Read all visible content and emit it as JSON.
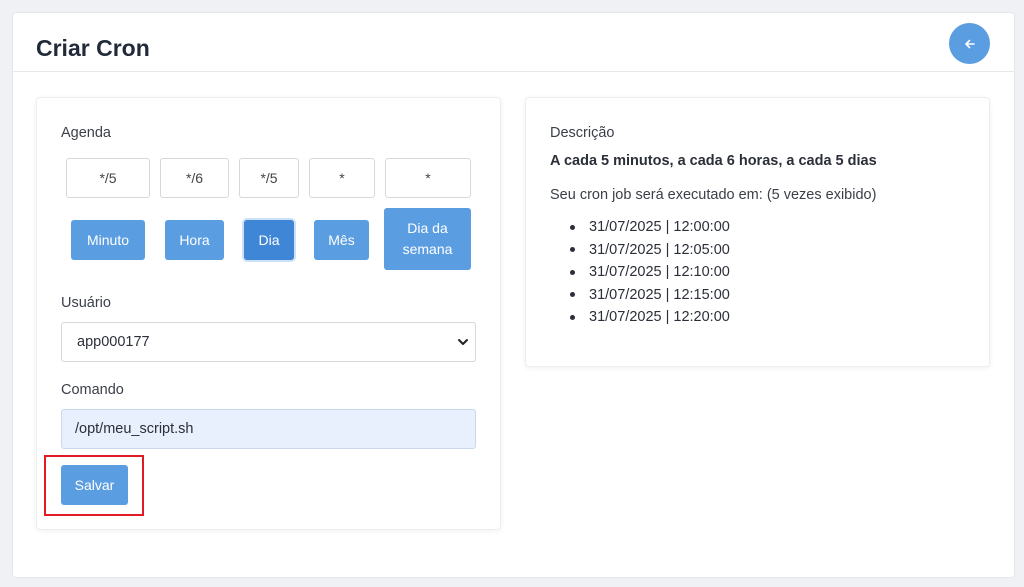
{
  "page": {
    "title": "Criar Cron",
    "back_icon": "arrow-left-icon"
  },
  "schedule": {
    "label": "Agenda",
    "fields": [
      {
        "value": "*/5",
        "unit": "Minuto",
        "active": false
      },
      {
        "value": "*/6",
        "unit": "Hora",
        "active": false
      },
      {
        "value": "*/5",
        "unit": "Dia",
        "active": true
      },
      {
        "value": "*",
        "unit": "Mês",
        "active": false
      },
      {
        "value": "*",
        "unit": "Dia da semana",
        "active": false
      }
    ]
  },
  "user": {
    "label": "Usuário",
    "selected": "app000177"
  },
  "command": {
    "label": "Comando",
    "value": "/opt/meu_script.sh"
  },
  "save_label": "Salvar",
  "description": {
    "title": "Descrição",
    "summary": "A cada 5 minutos, a cada 6 horas, a cada 5 dias",
    "runs_label": "Seu cron job será executado em: (5 vezes exibido)",
    "runs": [
      "31/07/2025 | 12:00:00",
      "31/07/2025 | 12:05:00",
      "31/07/2025 | 12:10:00",
      "31/07/2025 | 12:15:00",
      "31/07/2025 | 12:20:00"
    ]
  },
  "colors": {
    "primary": "#5a9de0",
    "active": "#3f86d6",
    "highlight": "#e01b24"
  }
}
